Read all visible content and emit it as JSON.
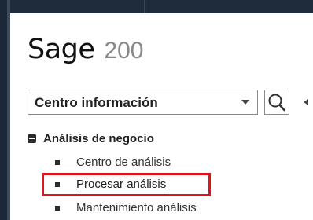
{
  "logo": {
    "brand": "Sage",
    "version": "200"
  },
  "selector": {
    "value": "Centro información",
    "icon": "chevron-down-icon"
  },
  "search": {
    "icon": "search-icon"
  },
  "tree": {
    "group": {
      "label": "Análisis de negocio",
      "expanded": true
    },
    "items": [
      {
        "label": "Centro de análisis"
      },
      {
        "label": "Procesar análisis",
        "highlighted": true
      },
      {
        "label": "Mantenimiento análisis"
      }
    ]
  },
  "colors": {
    "frame": "#1f2c3b",
    "highlight": "#e3131b",
    "text": "#222222"
  }
}
